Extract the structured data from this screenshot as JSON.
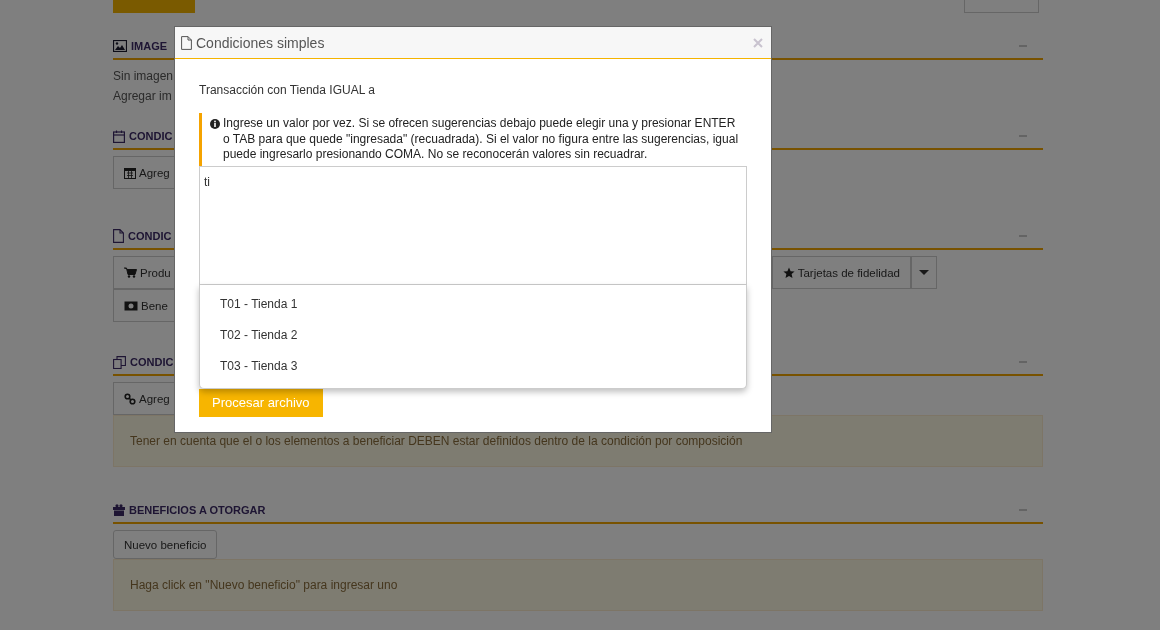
{
  "page": {
    "sections": [
      {
        "kind": "images",
        "title": "IMAGE",
        "lines": [
          "Sin imagen",
          "Agregar im"
        ]
      },
      {
        "kind": "dates",
        "title": "CONDIC",
        "buttons": [
          {
            "label": "Agreg"
          }
        ]
      },
      {
        "kind": "products",
        "title": "CONDIC",
        "buttons": [
          {
            "label": "Produ"
          },
          {
            "label": "Bene"
          }
        ],
        "extra_button": {
          "label": "Tarjetas de fidelidad"
        }
      },
      {
        "kind": "composition",
        "title": "CONDIC",
        "buttons": [
          {
            "label": "Agreg"
          }
        ],
        "note": "Tener en cuenta que el o los elementos a beneficiar DEBEN estar definidos dentro de la condición por composición"
      },
      {
        "kind": "benefits",
        "title": "BENEFICIOS A OTORGAR",
        "buttons": [
          {
            "label": "Nuevo beneficio"
          }
        ],
        "note": "Haga click en \"Nuevo beneficio\" para ingresar uno"
      }
    ]
  },
  "modal": {
    "title": "Condiciones simples",
    "field_label": "Transacción con Tienda IGUAL a",
    "hint": "Ingrese un valor por vez. Si se ofrecen sugerencias debajo puede elegir una y presionar ENTER o TAB para que quede \"ingresada\" (recuadrada). Si el valor no figura entre las sugerencias, igual puede ingresarlo presionando COMA. No se reconocerán valores sin recuadrar.",
    "value": "ti",
    "suggestions": [
      {
        "label": "T01 - Tienda 1",
        "selected": false
      },
      {
        "label": "T02 - Tienda 2",
        "selected": false
      },
      {
        "label": "T03 - Tienda 3",
        "selected": false
      }
    ],
    "submit": "Procesar archivo"
  }
}
